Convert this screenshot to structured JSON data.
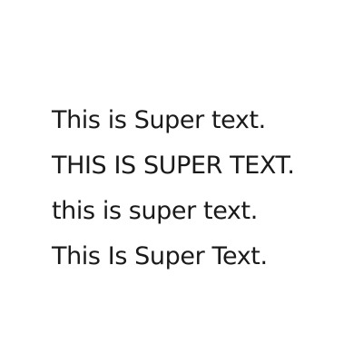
{
  "lines": [
    "This is Super text.",
    "THIS IS SUPER TEXT.",
    "this is super text.",
    "This Is Super Text."
  ],
  "colors": {
    "background": "#ffffff",
    "text": "#1a1a1a"
  }
}
